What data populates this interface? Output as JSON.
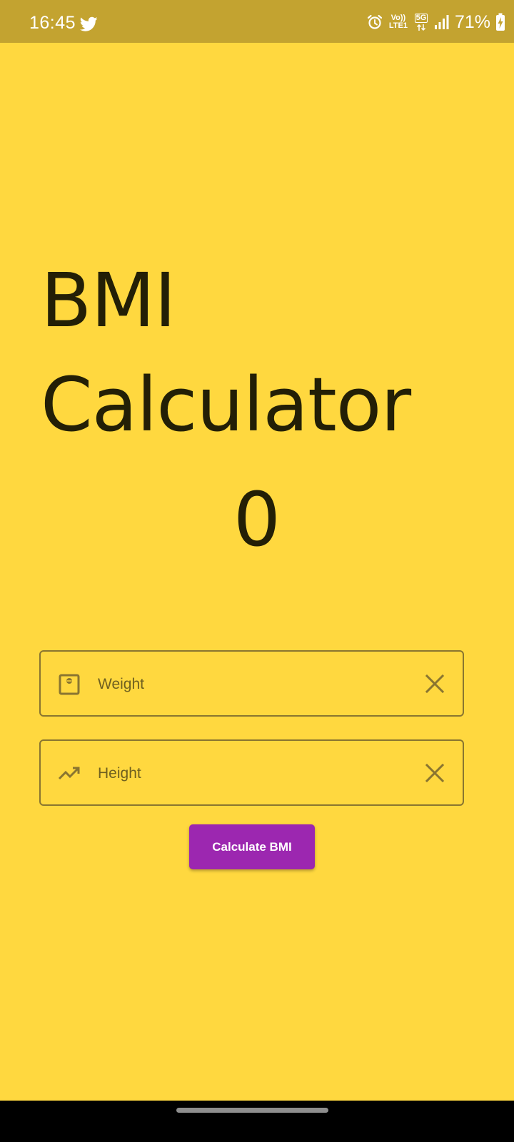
{
  "status_bar": {
    "time": "16:45",
    "volte_line1": "Vo))",
    "volte_line2": "LTE1",
    "network": "5G",
    "battery": "71%"
  },
  "app": {
    "title": "BMI Calculator",
    "bmi_value": "0"
  },
  "weight_field": {
    "placeholder": "Weight",
    "icon": "scale-icon"
  },
  "height_field": {
    "placeholder": "Height",
    "icon": "trending-up-icon"
  },
  "calculate_button": {
    "label": "Calculate BMI"
  },
  "colors": {
    "background": "#FFD83F",
    "status_bar": "#C3A330",
    "button": "#9C27B0",
    "text": "#231F06"
  }
}
